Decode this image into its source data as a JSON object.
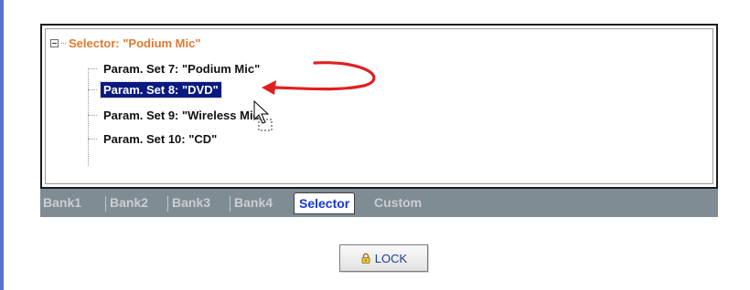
{
  "tree": {
    "root_label": "Selector: \"Podium Mic\"",
    "items": [
      {
        "label": "Param. Set 7: \"Podium Mic\"",
        "selected": false
      },
      {
        "label": "Param. Set 8: \"DVD\"",
        "selected": true
      },
      {
        "label": "Param. Set 9: \"Wireless Mic\"",
        "selected": false
      },
      {
        "label": "Param. Set 10: \"CD\"",
        "selected": false
      }
    ]
  },
  "tabs": [
    {
      "label": "Bank1",
      "active": false
    },
    {
      "label": "Bank2",
      "active": false
    },
    {
      "label": "Bank3",
      "active": false
    },
    {
      "label": "Bank4",
      "active": false
    },
    {
      "label": "Selector",
      "active": true
    },
    {
      "label": "Custom",
      "active": false
    }
  ],
  "lock_button": {
    "label": "LOCK",
    "icon": "lock-icon"
  },
  "colors": {
    "root_label": "#e07a2e",
    "selection_bg": "#0a1a80",
    "tabbar_bg": "#7f8c93",
    "active_tab_text": "#1a35d8",
    "arrow": "#e02020"
  }
}
